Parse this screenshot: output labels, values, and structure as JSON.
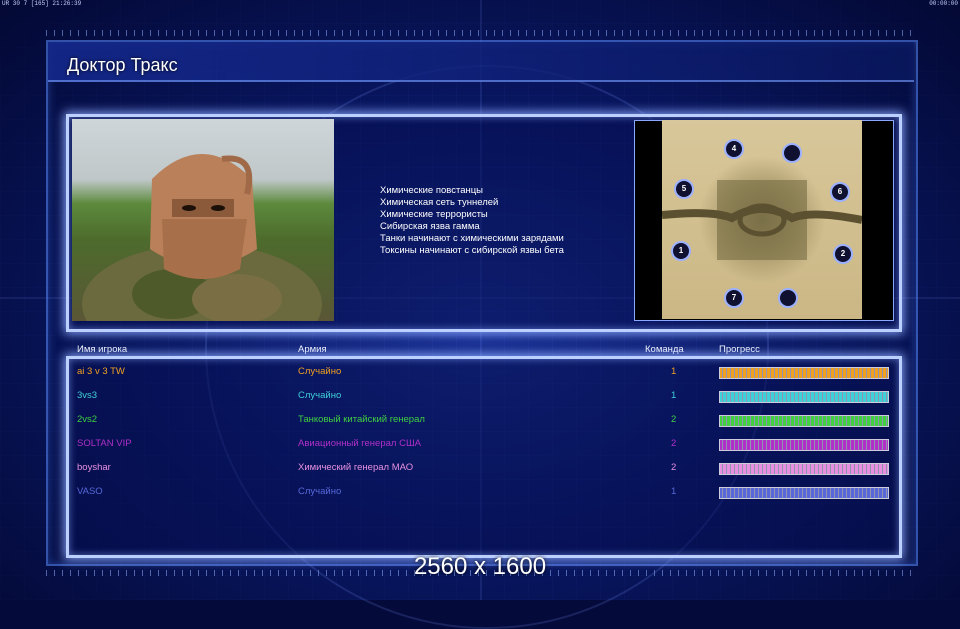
{
  "topbar": {
    "left": "UR 30 7 [165] 21:26:39",
    "right": "00:00:00"
  },
  "title": "Доктор Тракс",
  "briefing": [
    "Химические повстанцы",
    "Химическая сеть туннелей",
    "Химические террористы",
    "Сибирская язва гамма",
    "Танки начинают с химическими зарядами",
    "Токсины начинают с сибирской язвы бета"
  ],
  "minimap": {
    "spots": [
      "4",
      "",
      "5",
      "6",
      "1",
      "2",
      "7",
      ""
    ]
  },
  "columns": {
    "name": "Имя игрока",
    "army": "Армия",
    "team": "Команда",
    "progress": "Прогресс"
  },
  "players": [
    {
      "name": "ai 3 v 3 TW",
      "army": "Случайно",
      "team": "1",
      "color": "#f0a020",
      "progress": 1.0
    },
    {
      "name": "3vs3",
      "army": "Случайно",
      "team": "1",
      "color": "#40d0d8",
      "progress": 1.0
    },
    {
      "name": "2vs2",
      "army": "Танковый китайский генерал",
      "team": "2",
      "color": "#40d040",
      "progress": 1.0
    },
    {
      "name": "SOLTAN VIP",
      "army": "Авиационный генерал США",
      "team": "2",
      "color": "#b030c8",
      "progress": 1.0
    },
    {
      "name": "boyshar",
      "army": "Химический генерал МАО",
      "team": "2",
      "color": "#e890e0",
      "progress": 1.0
    },
    {
      "name": "VASO",
      "army": "Случайно",
      "team": "1",
      "color": "#5868d8",
      "progress": 1.0
    }
  ],
  "footer": "2560 x 1600"
}
